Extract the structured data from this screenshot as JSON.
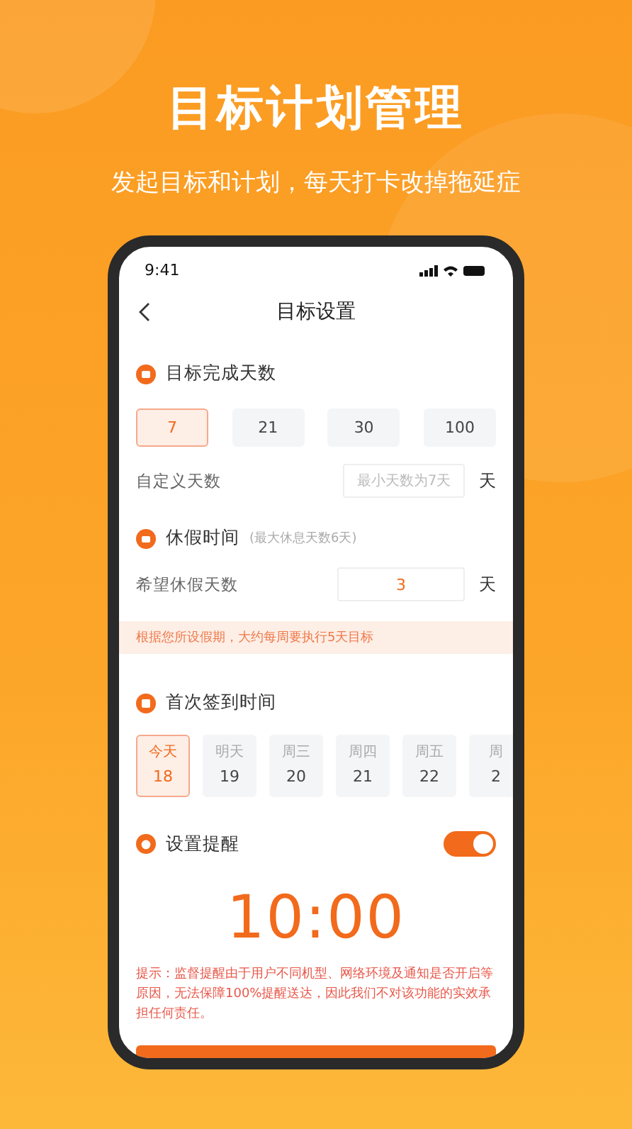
{
  "headline": "目标计划管理",
  "subheadline": "发起目标和计划，每天打卡改掉拖延症",
  "status_bar": {
    "time": "9:41"
  },
  "nav": {
    "title": "目标设置"
  },
  "goal_days": {
    "title": "目标完成天数",
    "options": [
      {
        "label": "7",
        "selected": true
      },
      {
        "label": "21",
        "selected": false
      },
      {
        "label": "30",
        "selected": false
      },
      {
        "label": "100",
        "selected": false
      }
    ],
    "custom_label": "自定义天数",
    "custom_placeholder": "最小天数为7天",
    "unit": "天"
  },
  "rest": {
    "title": "休假时间",
    "hint": "(最大休息天数6天)",
    "label": "希望休假天数",
    "value": "3",
    "unit": "天",
    "notice": "根据您所设假期，大约每周要执行5天目标"
  },
  "first_checkin": {
    "title": "首次签到时间",
    "days": [
      {
        "weekday": "今天",
        "date": "18",
        "selected": true
      },
      {
        "weekday": "明天",
        "date": "19",
        "selected": false
      },
      {
        "weekday": "周三",
        "date": "20",
        "selected": false
      },
      {
        "weekday": "周四",
        "date": "21",
        "selected": false
      },
      {
        "weekday": "周五",
        "date": "22",
        "selected": false
      },
      {
        "weekday": "周",
        "date": "2",
        "selected": false
      }
    ]
  },
  "reminder": {
    "title": "设置提醒",
    "on": true,
    "time": "10:00",
    "note": "提示：监督提醒由于用户不同机型、网络环境及通知是否开启等原因，无法保障100%提醒送达，因此我们不对该功能的实效承担任何责任。"
  }
}
